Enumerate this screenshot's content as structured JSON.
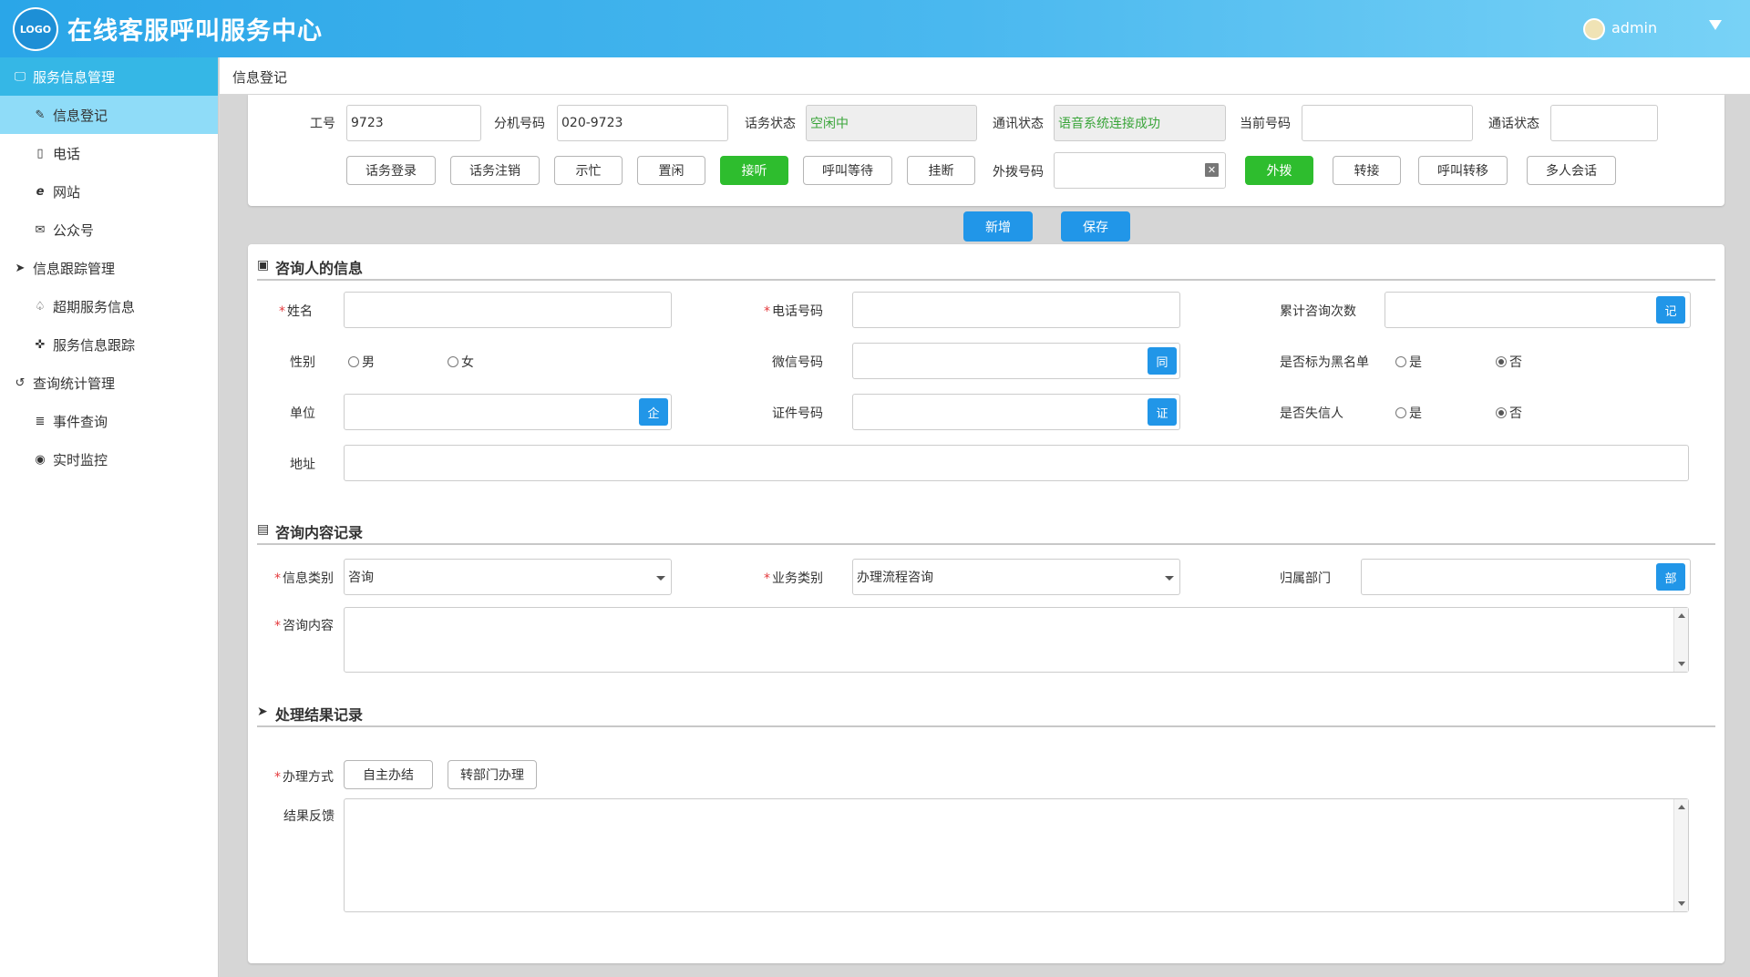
{
  "header": {
    "logo_text": "LOGO",
    "app_title": "在线客服呼叫服务中心",
    "user_name": "admin"
  },
  "sidebar": {
    "groups": [
      {
        "label": "服务信息管理",
        "icon": "monitor-icon",
        "items": [
          {
            "label": "信息登记",
            "icon": "edit-icon"
          },
          {
            "label": "电话",
            "icon": "mobile-icon"
          },
          {
            "label": "网站",
            "icon": "ie-icon"
          },
          {
            "label": "公众号",
            "icon": "envelope-icon"
          }
        ]
      },
      {
        "label": "信息跟踪管理",
        "icon": "send-icon",
        "items": [
          {
            "label": "超期服务信息",
            "icon": "bell-icon"
          },
          {
            "label": "服务信息跟踪",
            "icon": "crosshair-icon"
          }
        ]
      },
      {
        "label": "查询统计管理",
        "icon": "history-icon",
        "items": [
          {
            "label": "事件查询",
            "icon": "database-icon"
          },
          {
            "label": "实时监控",
            "icon": "play-circle-icon"
          }
        ]
      }
    ]
  },
  "breadcrumb": {
    "current": "信息登记"
  },
  "status_bar": {
    "job_no_label": "工号",
    "job_no_value": "9723",
    "ext_label": "分机号码",
    "ext_value": "020-9723",
    "call_status_label": "话务状态",
    "call_status_value": "空闲中",
    "comm_status_label": "通讯状态",
    "comm_status_value": "语音系统连接成功",
    "current_no_label": "当前号码",
    "current_no_value": "",
    "talk_status_label": "通话状态",
    "talk_status_value": "",
    "buttons": [
      "话务登录",
      "话务注销",
      "示忙",
      "置闲",
      "接听",
      "呼叫等待",
      "挂断"
    ],
    "dial_label": "外拨号码",
    "dial_value": "",
    "dial_buttons": [
      "外拨",
      "转接",
      "呼叫转移",
      "多人会话"
    ]
  },
  "actions": {
    "add": "新增",
    "save": "保存"
  },
  "consultant": {
    "title": "咨询人的信息",
    "name_label": "姓名",
    "name_value": "",
    "phone_label": "电话号码",
    "phone_value": "",
    "count_label": "累计咨询次数",
    "count_value": "",
    "count_btn": "记",
    "gender_label": "性别",
    "gender_male": "男",
    "gender_female": "女",
    "wechat_label": "微信号码",
    "wechat_value": "",
    "wechat_btn": "同",
    "blacklist_label": "是否标为黑名单",
    "yes": "是",
    "no": "否",
    "unit_label": "单位",
    "unit_value": "",
    "unit_btn": "企",
    "id_label": "证件号码",
    "id_value": "",
    "id_btn": "证",
    "dishonest_label": "是否失信人",
    "address_label": "地址",
    "address_value": ""
  },
  "consult_record": {
    "title": "咨询内容记录",
    "info_type_label": "信息类别",
    "info_type_value": "咨询",
    "biz_type_label": "业务类别",
    "biz_type_value": "办理流程咨询",
    "dept_label": "归属部门",
    "dept_value": "",
    "dept_btn": "部",
    "content_label": "咨询内容",
    "content_value": ""
  },
  "result_record": {
    "title": "处理结果记录",
    "method_label": "办理方式",
    "method_buttons": [
      "自主办结",
      "转部门办理"
    ],
    "feedback_label": "结果反馈",
    "feedback_value": ""
  }
}
